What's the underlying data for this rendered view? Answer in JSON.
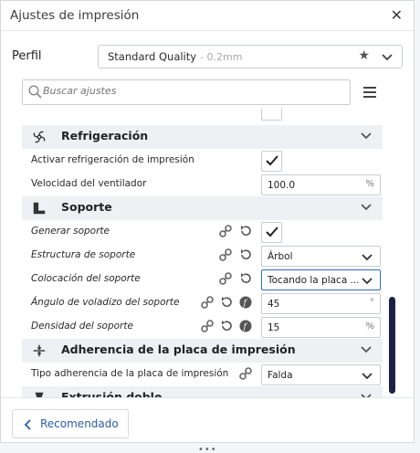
{
  "dialog": {
    "title": "Ajustes de impresión",
    "close_icon": "close-icon"
  },
  "profile": {
    "label": "Perfil",
    "name": "Standard Quality",
    "layer_height": "- 0.2mm"
  },
  "search": {
    "placeholder": "Buscar ajustes"
  },
  "sections": {
    "cooling": {
      "title": "Refrigeración",
      "enable_cooling": {
        "label": "Activar refrigeración de impresión",
        "checked": true
      },
      "fan_speed": {
        "label": "Velocidad del ventilador",
        "value": "100.0",
        "unit": "%"
      }
    },
    "support": {
      "title": "Soporte",
      "generate": {
        "label": "Generar soporte",
        "checked": true
      },
      "structure": {
        "label": "Estructura de soporte",
        "value": "Árbol"
      },
      "placement": {
        "label": "Colocación del soporte",
        "value": "Tocando la placa ..."
      },
      "overhang_angle": {
        "label": "Ángulo de voladizo del soporte",
        "value": "45",
        "unit": "°"
      },
      "density": {
        "label": "Densidad del soporte",
        "value": "15",
        "unit": "%"
      }
    },
    "adhesion": {
      "title": "Adherencia de la placa de impresión",
      "type": {
        "label": "Tipo adherencia de la placa de impresión",
        "value": "Falda"
      }
    },
    "dual": {
      "title": "Extrusión doble"
    }
  },
  "footer": {
    "recommended_label": "Recomendado"
  },
  "colors": {
    "accent": "#2d6cc4",
    "scrollbar": "#1c2145",
    "link": "#2a5ba8"
  }
}
